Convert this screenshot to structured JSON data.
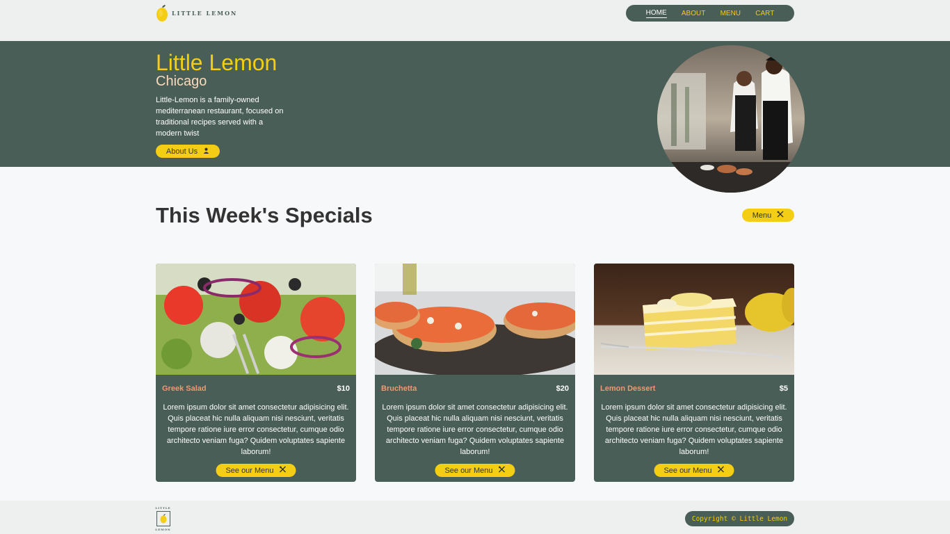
{
  "header": {
    "logo_text": "LITTLE LEMON",
    "nav": [
      {
        "label": "HOME",
        "active": true
      },
      {
        "label": "ABOUT",
        "active": false
      },
      {
        "label": "MENU",
        "active": false
      },
      {
        "label": "CART",
        "active": false
      }
    ]
  },
  "hero": {
    "title": "Little Lemon",
    "subtitle": "Chicago",
    "description": "Little-Lemon is a family-owned mediterranean restaurant, focused on traditional recipes served with a modern twist",
    "button_label": "About Us",
    "button_icon": "user-icon",
    "image": "restaurant-chefs-photo"
  },
  "specials": {
    "title": "This Week's Specials",
    "menu_button_label": "Menu",
    "menu_button_icon": "utensils-icon",
    "cards": [
      {
        "name": "Greek Salad",
        "price": "$10",
        "description": "Lorem ipsum dolor sit amet consectetur adipisicing elit. Quis placeat hic nulla aliquam nisi nesciunt, veritatis tempore ratione iure error consectetur, cumque odio architecto veniam fuga? Quidem voluptates sapiente laborum!",
        "button_label": "See our Menu",
        "image": "greek-salad-photo"
      },
      {
        "name": "Bruchetta",
        "price": "$20",
        "description": "Lorem ipsum dolor sit amet consectetur adipisicing elit. Quis placeat hic nulla aliquam nisi nesciunt, veritatis tempore ratione iure error consectetur, cumque odio architecto veniam fuga? Quidem voluptates sapiente laborum!",
        "button_label": "See our Menu",
        "image": "bruchetta-photo"
      },
      {
        "name": "Lemon Dessert",
        "price": "$5",
        "description": "Lorem ipsum dolor sit amet consectetur adipisicing elit. Quis placeat hic nulla aliquam nisi nesciunt, veritatis tempore ratione iure error consectetur, cumque odio architecto veniam fuga? Quidem voluptates sapiente laborum!",
        "button_label": "See our Menu",
        "image": "lemon-dessert-photo"
      }
    ]
  },
  "footer": {
    "logo_top": "LITTLE",
    "logo_bottom": "LEMON",
    "copyright": "Copyright © Little Lemon"
  },
  "colors": {
    "primary_green": "#495e57",
    "primary_yellow": "#f4ce14",
    "salmon": "#ee9972",
    "peach": "#fbdabb",
    "background": "#f7f8fa",
    "header_bg": "#eeefef"
  }
}
